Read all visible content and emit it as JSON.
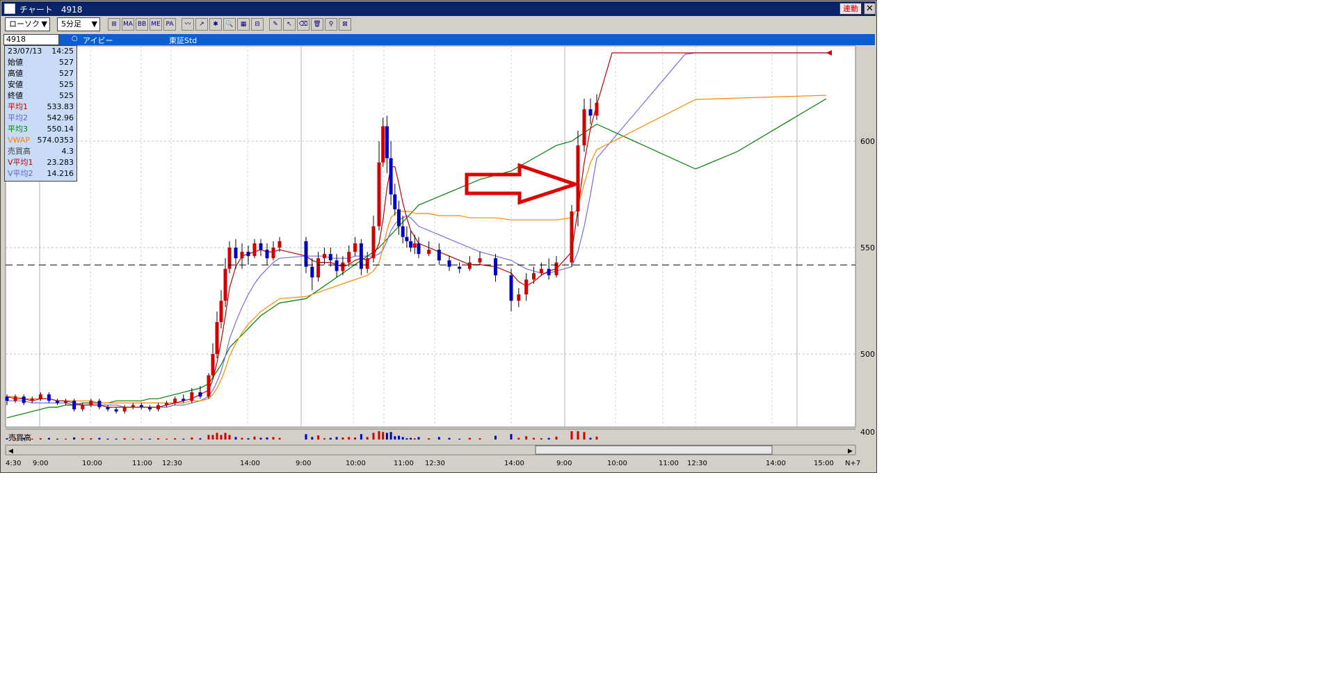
{
  "window": {
    "title": "チャート　4918",
    "link_label": "連動",
    "close_label": "✕"
  },
  "toolbar": {
    "chart_type": "ローソク",
    "interval": "5分足",
    "dropdown_arrow": "▼",
    "buttons": [
      {
        "icon": "crosshair-icon",
        "label": "⊞"
      },
      {
        "icon": "ma-icon",
        "label": "MA"
      },
      {
        "icon": "bb-icon",
        "label": "BB"
      },
      {
        "icon": "me-icon",
        "label": "ME"
      },
      {
        "icon": "pa-icon",
        "label": "PA"
      },
      {
        "icon": "line-chart-icon",
        "label": "〰"
      },
      {
        "icon": "trend-icon",
        "label": "↗"
      },
      {
        "icon": "sparkle-icon",
        "label": "✱"
      },
      {
        "icon": "zoom-icon",
        "label": "🔍"
      },
      {
        "icon": "grid-icon",
        "label": "▦"
      },
      {
        "icon": "compare-icon",
        "label": "⊟"
      },
      {
        "icon": "pencil-icon",
        "label": "✎"
      },
      {
        "icon": "pointer-icon",
        "label": "↖"
      },
      {
        "icon": "eraser-icon",
        "label": "⌫"
      },
      {
        "icon": "trash-icon",
        "label": "🗑"
      },
      {
        "icon": "search-icon",
        "label": "⚲"
      },
      {
        "icon": "crossout-icon",
        "label": "⊠"
      }
    ]
  },
  "infobar": {
    "code": "4918",
    "radio": "○",
    "name": "アイビー",
    "market": "東証Std"
  },
  "data_panel": {
    "date": "23/07/13",
    "time": "14:25",
    "rows": [
      {
        "label": "始値",
        "value": "527",
        "color": "#000000"
      },
      {
        "label": "高値",
        "value": "527",
        "color": "#000000"
      },
      {
        "label": "安値",
        "value": "525",
        "color": "#000000"
      },
      {
        "label": "終値",
        "value": "525",
        "color": "#000000"
      },
      {
        "label": "平均1",
        "value": "533.83",
        "color": "#c00000"
      },
      {
        "label": "平均2",
        "value": "542.96",
        "color": "#6060d0"
      },
      {
        "label": "平均3",
        "value": "550.14",
        "color": "#008000"
      },
      {
        "label": "VWAP",
        "value": "574.0353",
        "color": "#ff8000"
      },
      {
        "label": "売買高",
        "value": "4.3",
        "color": "#404040"
      },
      {
        "label": "V平均1",
        "value": "23.283",
        "color": "#c00000"
      },
      {
        "label": "V平均2",
        "value": "14.216",
        "color": "#6060d0"
      }
    ]
  },
  "volume_label": "売買高",
  "axis": {
    "y_ticks": [
      "600",
      "550",
      "500",
      "400"
    ],
    "x_ticks": [
      "4:30",
      "9:00",
      "10:00",
      "11:00",
      "12:30",
      "14:00",
      "9:00",
      "10:00",
      "11:00",
      "12:30",
      "14:00",
      "9:00",
      "10:00",
      "11:00",
      "12:30",
      "14:00",
      "15:00",
      "N+7"
    ]
  },
  "colors": {
    "up_candle": "#d00000",
    "down_candle": "#0000c0",
    "ma1": "#c00000",
    "ma2": "#7070e0",
    "ma3": "#008000",
    "vwap": "#ff8800",
    "arrow": "#e00000"
  },
  "chart_data": {
    "type": "line",
    "ylim": [
      400,
      620
    ],
    "reference_line": 541,
    "candles": [
      [
        480,
        478,
        481,
        476
      ],
      [
        478,
        480,
        481,
        477
      ],
      [
        480,
        477,
        481,
        476
      ],
      [
        478,
        479,
        480,
        477
      ],
      [
        479,
        481,
        482,
        478
      ],
      [
        481,
        478,
        482,
        477
      ],
      [
        478,
        477,
        479,
        476
      ],
      [
        477,
        478,
        479,
        476
      ],
      [
        478,
        474,
        479,
        473
      ],
      [
        474,
        476,
        477,
        473
      ],
      [
        476,
        478,
        479,
        475
      ],
      [
        478,
        475,
        479,
        474
      ],
      [
        475,
        474,
        476,
        473
      ],
      [
        474,
        473,
        475,
        472
      ],
      [
        473,
        475,
        476,
        472
      ],
      [
        475,
        476,
        477,
        474
      ],
      [
        476,
        475,
        477,
        474
      ],
      [
        475,
        474,
        476,
        473
      ],
      [
        474,
        476,
        477,
        473
      ],
      [
        476,
        477,
        478,
        475
      ],
      [
        477,
        479,
        480,
        476
      ],
      [
        479,
        478,
        481,
        477
      ],
      [
        478,
        482,
        484,
        477
      ],
      [
        482,
        480,
        485,
        479
      ],
      [
        480,
        490,
        491,
        479
      ],
      [
        490,
        500,
        505,
        489
      ],
      [
        500,
        515,
        520,
        498
      ],
      [
        515,
        525,
        530,
        512
      ],
      [
        525,
        540,
        545,
        522
      ],
      [
        540,
        550,
        553,
        538
      ],
      [
        550,
        545,
        554,
        540
      ],
      [
        545,
        548,
        552,
        540
      ],
      [
        548,
        546,
        551,
        542
      ],
      [
        546,
        552,
        554,
        545
      ],
      [
        552,
        549,
        554,
        546
      ],
      [
        549,
        545,
        552,
        542
      ],
      [
        545,
        550,
        553,
        544
      ],
      [
        550,
        553,
        555,
        548
      ],
      [
        553,
        541,
        555,
        538
      ],
      [
        541,
        536,
        545,
        530
      ],
      [
        536,
        545,
        548,
        534
      ],
      [
        545,
        547,
        550,
        542
      ],
      [
        547,
        544,
        550,
        541
      ],
      [
        544,
        539,
        547,
        536
      ],
      [
        539,
        543,
        546,
        537
      ],
      [
        543,
        548,
        551,
        541
      ],
      [
        548,
        552,
        555,
        546
      ],
      [
        552,
        540,
        554,
        537
      ],
      [
        540,
        545,
        548,
        538
      ],
      [
        545,
        560,
        565,
        543
      ],
      [
        560,
        590,
        600,
        558
      ],
      [
        590,
        607,
        611,
        588
      ],
      [
        607,
        592,
        612,
        585
      ],
      [
        592,
        575,
        600,
        570
      ],
      [
        575,
        568,
        580,
        565
      ],
      [
        568,
        560,
        572,
        556
      ],
      [
        560,
        555,
        565,
        552
      ],
      [
        555,
        553,
        560,
        550
      ],
      [
        553,
        550,
        558,
        548
      ],
      [
        550,
        552,
        556,
        547
      ],
      [
        552,
        547,
        555,
        545
      ],
      [
        547,
        549,
        553,
        546
      ],
      [
        549,
        544,
        552,
        542
      ],
      [
        544,
        541,
        546,
        539
      ],
      [
        541,
        540,
        543,
        538
      ],
      [
        540,
        543,
        546,
        539
      ],
      [
        543,
        545,
        548,
        542
      ],
      [
        545,
        537,
        547,
        534
      ],
      [
        537,
        525,
        540,
        520
      ],
      [
        525,
        528,
        531,
        522
      ],
      [
        528,
        535,
        538,
        525
      ],
      [
        535,
        538,
        541,
        533
      ],
      [
        538,
        540,
        543,
        537
      ],
      [
        540,
        537,
        545,
        535
      ],
      [
        537,
        543,
        546,
        536
      ],
      [
        543,
        567,
        570,
        541
      ],
      [
        567,
        598,
        605,
        560
      ],
      [
        598,
        615,
        620,
        595
      ],
      [
        615,
        612,
        620,
        608
      ],
      [
        612,
        618,
        622,
        610
      ]
    ],
    "ma1": [
      480,
      479,
      479,
      478,
      479,
      479,
      478,
      478,
      477,
      476,
      476,
      476,
      475,
      475,
      475,
      475,
      475,
      475,
      475,
      476,
      477,
      478,
      479,
      481,
      483,
      488,
      496,
      506,
      518,
      531,
      541,
      546,
      547,
      548,
      549,
      548,
      548,
      549,
      546,
      544,
      543,
      543,
      543,
      542,
      541,
      542,
      544,
      545,
      544,
      546,
      552,
      563,
      578,
      588,
      588,
      580,
      571,
      564,
      558,
      555,
      552,
      550,
      548,
      546,
      544,
      542,
      542,
      541,
      538,
      534,
      532,
      534,
      537,
      539,
      540,
      548,
      568,
      590,
      606,
      617
    ],
    "ma2": [
      478,
      478,
      478,
      477,
      477,
      477,
      477,
      477,
      476,
      476,
      476,
      476,
      476,
      476,
      475,
      475,
      475,
      475,
      475,
      475,
      476,
      476,
      477,
      478,
      480,
      483,
      487,
      492,
      499,
      507,
      515,
      522,
      528,
      533,
      537,
      540,
      543,
      545,
      546,
      546,
      546,
      546,
      545,
      545,
      545,
      545,
      546,
      546,
      546,
      546,
      547,
      549,
      553,
      558,
      561,
      563,
      564,
      565,
      564,
      562,
      560,
      558,
      556,
      554,
      552,
      550,
      548,
      546,
      544,
      542,
      540,
      539,
      538,
      538,
      539,
      541,
      548,
      560,
      575,
      592
    ],
    "ma3": [
      470,
      471,
      472,
      473,
      474,
      475,
      475,
      476,
      476,
      477,
      477,
      477,
      477,
      478,
      478,
      478,
      478,
      479,
      479,
      480,
      481,
      482,
      483,
      484,
      486,
      489,
      492,
      495,
      499,
      503,
      506,
      509,
      512,
      515,
      518,
      520,
      522,
      524,
      526,
      528,
      530,
      532,
      534,
      536,
      538,
      540,
      542,
      544,
      546,
      548,
      550,
      552,
      554,
      556,
      558,
      560,
      562,
      564,
      566,
      568,
      570,
      572,
      574,
      576,
      578,
      580,
      582,
      584,
      586,
      588,
      590,
      592,
      594,
      596,
      598,
      600,
      602,
      604,
      606,
      608
    ],
    "vwap": [
      480,
      480,
      479,
      479,
      479,
      479,
      478,
      478,
      478,
      478,
      478,
      477,
      477,
      477,
      477,
      477,
      477,
      477,
      477,
      477,
      477,
      477,
      478,
      478,
      479,
      481,
      484,
      488,
      493,
      499,
      505,
      510,
      514,
      517,
      520,
      522,
      524,
      526,
      527,
      528,
      529,
      530,
      531,
      532,
      533,
      534,
      535,
      536,
      537,
      539,
      543,
      550,
      558,
      564,
      566,
      567,
      567,
      567,
      567,
      566,
      566,
      566,
      565,
      565,
      565,
      564,
      564,
      564,
      563,
      563,
      563,
      563,
      563,
      563,
      563,
      564,
      569,
      580,
      590,
      596
    ]
  }
}
